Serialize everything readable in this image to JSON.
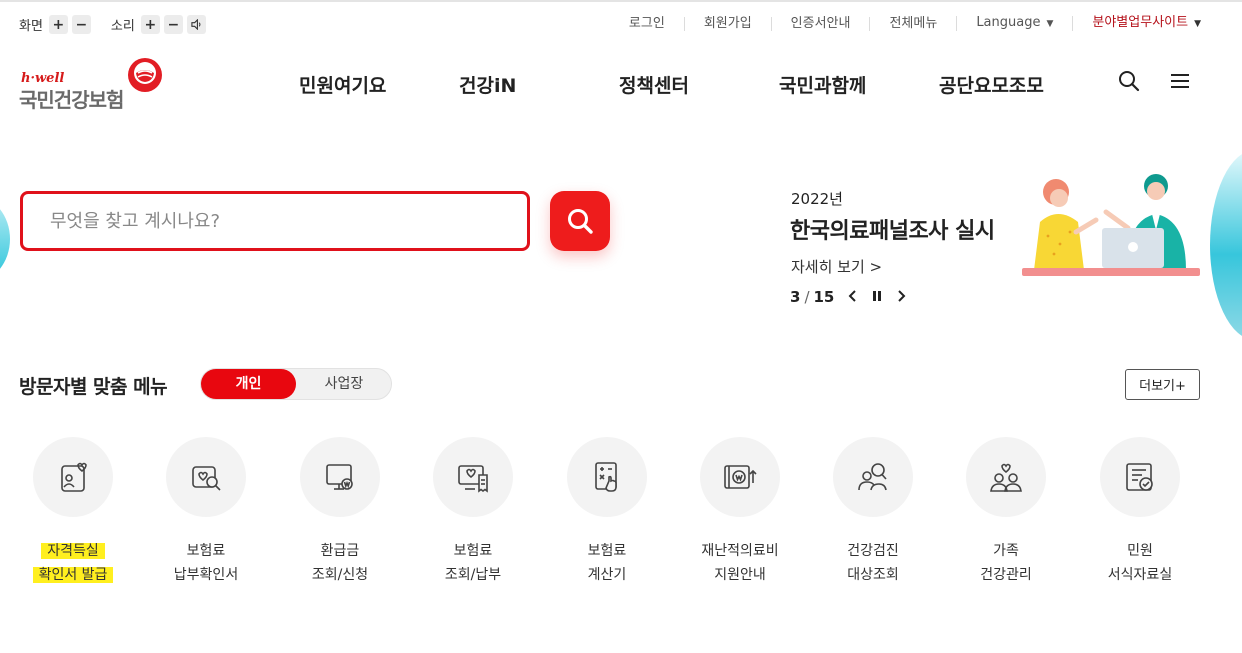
{
  "utility": {
    "screen_label": "화면",
    "sound_label": "소리",
    "plus": "+",
    "minus": "−",
    "links": [
      "로그인",
      "회원가입",
      "인증서안내",
      "전체메뉴",
      "Language",
      "분야별업무사이트"
    ]
  },
  "logo": {
    "small": "h·well",
    "main": "국민건강보험"
  },
  "gnb": [
    "민원여기요",
    "건강iN",
    "정책센터",
    "국민과함께",
    "공단요모조모"
  ],
  "search": {
    "placeholder": "무엇을 찾고 계시나요?"
  },
  "banner": {
    "year": "2022년",
    "title": "한국의료패널조사 실시",
    "more": "자세히 보기 >",
    "current": "3",
    "total": "15"
  },
  "visitor": {
    "title": "방문자별 맞춤 메뉴",
    "tab_personal": "개인",
    "tab_business": "사업장",
    "more": "더보기+"
  },
  "services": [
    {
      "line1": "자격득실",
      "line2": "확인서 발급",
      "icon": "id-card-heart-icon"
    },
    {
      "line1": "보험료",
      "line2": "납부확인서",
      "icon": "heart-search-icon"
    },
    {
      "line1": "환급금",
      "line2": "조회/신청",
      "icon": "monitor-won-icon"
    },
    {
      "line1": "보험료",
      "line2": "조회/납부",
      "icon": "monitor-receipt-icon"
    },
    {
      "line1": "보험료",
      "line2": "계산기",
      "icon": "calculator-hand-icon"
    },
    {
      "line1": "재난적의료비",
      "line2": "지원안내",
      "icon": "card-won-arrow-icon"
    },
    {
      "line1": "건강검진",
      "line2": "대상조회",
      "icon": "people-search-icon"
    },
    {
      "line1": "가족",
      "line2": "건강관리",
      "icon": "family-heart-icon"
    },
    {
      "line1": "민원",
      "line2": "서식자료실",
      "icon": "document-check-icon"
    }
  ],
  "colors": {
    "accent": "#e8070f",
    "highlight": "#ffef1f",
    "site_link": "#b5121b"
  }
}
